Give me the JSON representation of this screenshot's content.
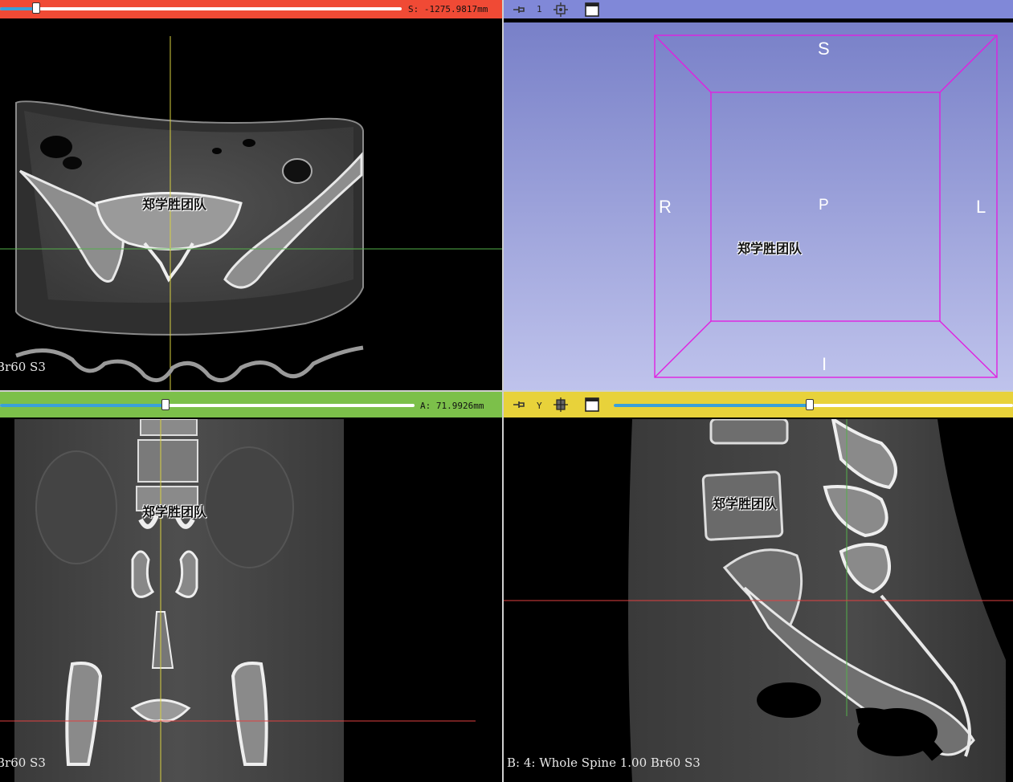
{
  "red_view": {
    "bar_color": "#f04a35",
    "slider_fraction": 0.09,
    "offset": "S: -1275.9817mm",
    "corner_label": "Br60 S3",
    "watermark": "郑学胜团队"
  },
  "threed_view": {
    "bar_color": "#8088d8",
    "view_number": "1",
    "orient_superior": "S",
    "orient_inferior": "I",
    "orient_right": "R",
    "orient_left": "L",
    "orient_posterior": "P",
    "box_color": "#e020e0",
    "watermark": "郑学胜团队",
    "icons": [
      "pin-icon",
      "center-view-icon",
      "maximize-view-icon"
    ]
  },
  "green_view": {
    "bar_color": "#7cc04a",
    "slider_fraction": 0.4,
    "offset": "A: 71.9926mm",
    "corner_label": "Br60 S3",
    "watermark": "郑学胜团队"
  },
  "yellow_view": {
    "bar_color": "#e8d23a",
    "slider_fraction": 0.49,
    "axis_letter": "Y",
    "corner_label": "B: 4: Whole Spine 1.00 Br60 S3",
    "watermark": "郑学胜团队",
    "icons": [
      "pin-icon",
      "slice-visibility-icon",
      "maximize-view-icon"
    ]
  }
}
